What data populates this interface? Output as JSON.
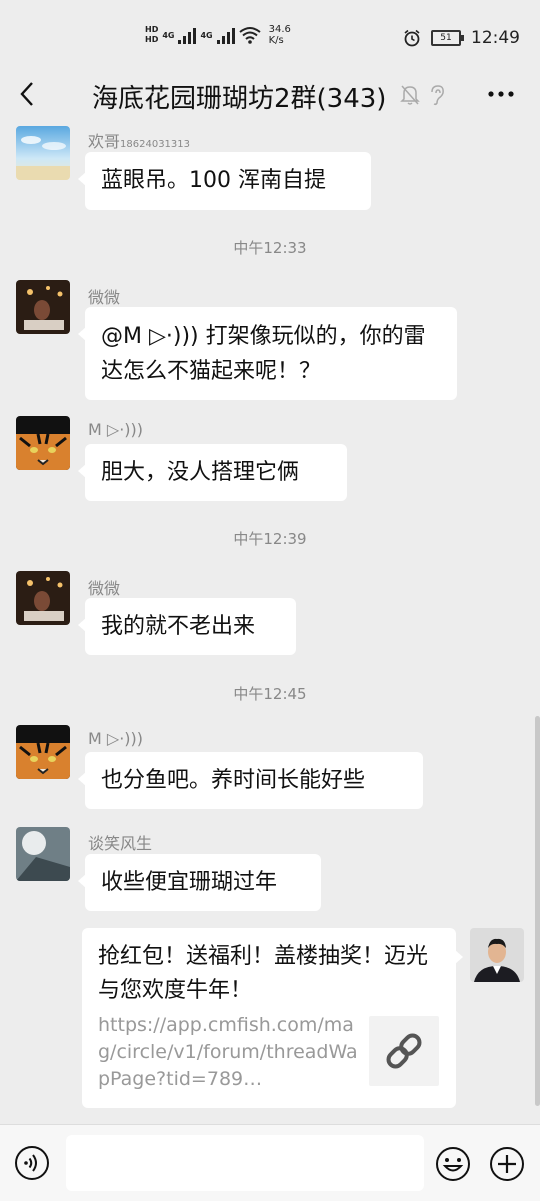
{
  "status": {
    "hd1": "HD",
    "hd2": "HD",
    "net1": "4G",
    "net2": "4G",
    "speed_value": "34.6",
    "speed_unit": "K/s",
    "battery": "51",
    "time": "12:49"
  },
  "header": {
    "title": "海底花园珊瑚坊2群(343)"
  },
  "messages": [
    {
      "sender": "欢哥",
      "sender_extra": "18624031313",
      "text": "蓝眼吊。100 浑南自提"
    },
    {
      "time": "中午12:33"
    },
    {
      "sender": "微微",
      "text": "@M ▷·))) 打架像玩似的，你的雷达怎么不猫起来呢！？"
    },
    {
      "sender": "M ▷·)))",
      "text": "胆大，没人搭理它俩"
    },
    {
      "time": "中午12:39"
    },
    {
      "sender": "微微",
      "text": "我的就不老出来"
    },
    {
      "time": "中午12:45"
    },
    {
      "sender": "M ▷·)))",
      "text": "也分鱼吧。养时间长能好些"
    },
    {
      "sender": "谈笑风生",
      "text": "收些便宜珊瑚过年"
    }
  ],
  "link_card": {
    "title": "抢红包！送福利！盖楼抽奖！迈光与您欢度牛年！",
    "url": "https://app.cmfish.com/mag/circle/v1/forum/threadWapPage?tid=789…"
  },
  "colors": {
    "background": "#ededed",
    "bubble": "#ffffff",
    "meta_text": "#888888"
  },
  "icons": [
    "back-icon",
    "mute-bell-icon",
    "ear-icon",
    "more-icon",
    "voice-icon",
    "emoji-icon",
    "plus-icon",
    "link-icon"
  ]
}
